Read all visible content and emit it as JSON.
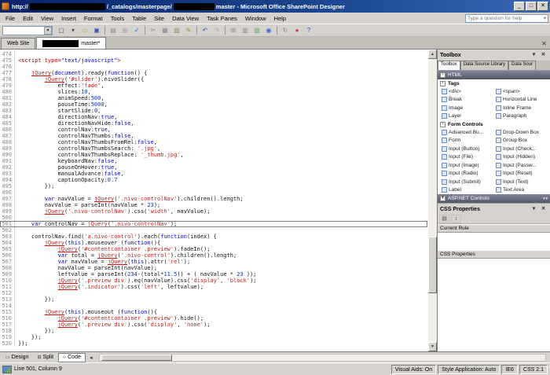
{
  "icons": {
    "chevron-down": "▾",
    "close": "✕",
    "scroll-up": "▲",
    "scroll-down": "▼",
    "categorize": "▤",
    "sort": "↕",
    "back": "◂",
    "minimize": "_",
    "maximize": "□"
  },
  "colors": {
    "titlebar": "#0a246a",
    "chrome": "#d6d3ce",
    "section_header": "#525767",
    "code_string": "#c21f1f",
    "code_keyword": "#0000d8",
    "redaction": "#000000"
  },
  "window": {
    "title_segments": [
      {
        "type": "text",
        "text": "http://"
      },
      {
        "type": "redacted",
        "w": 96
      },
      {
        "type": "text",
        "text": "/_catalogs/masterpage/"
      },
      {
        "type": "redacted",
        "w": 52
      },
      {
        "type": "text",
        "text": "master - Microsoft Office SharePoint Designer"
      }
    ],
    "controls": [
      {
        "name": "minimize-button",
        "glyph": "_"
      },
      {
        "name": "maximize-button",
        "glyph": "□"
      },
      {
        "name": "close-button",
        "glyph": "✕"
      }
    ]
  },
  "menu": {
    "items": [
      "File",
      "Edit",
      "View",
      "Insert",
      "Format",
      "Tools",
      "Table",
      "Site",
      "Data View",
      "Task Panes",
      "Window",
      "Help"
    ],
    "help_box": "Type a question for help"
  },
  "toolbar": {
    "icons": [
      {
        "name": "new-document-icon",
        "glyph": "▢",
        "color": "#555555"
      },
      {
        "name": "new-dropdown-chevron-icon",
        "glyph": "▾",
        "color": "#555555"
      },
      {
        "name": "open-folder-icon",
        "glyph": "▭",
        "color": "#c9a227"
      },
      {
        "name": "save-icon",
        "glyph": "▣",
        "color": "#3355aa"
      },
      {
        "sep": true
      },
      {
        "name": "print-icon",
        "glyph": "▤",
        "color": "#888888"
      },
      {
        "name": "print-preview-icon",
        "glyph": "◎",
        "color": "#888888"
      },
      {
        "name": "spelling-icon",
        "glyph": "✓",
        "color": "#3366cc"
      },
      {
        "sep": true
      },
      {
        "name": "cut-icon",
        "glyph": "✂",
        "color": "#888888"
      },
      {
        "name": "copy-icon",
        "glyph": "▦",
        "color": "#888888"
      },
      {
        "name": "paste-icon",
        "glyph": "▨",
        "color": "#998855"
      },
      {
        "name": "format-painter-icon",
        "glyph": "✎",
        "color": "#aa8833"
      },
      {
        "sep": true
      },
      {
        "name": "undo-icon",
        "glyph": "↶",
        "color": "#3366cc"
      },
      {
        "name": "redo-icon",
        "glyph": "↷",
        "color": "#aaaaaa"
      },
      {
        "sep": true
      },
      {
        "name": "insert-table-icon",
        "glyph": "⊞",
        "color": "#888888"
      },
      {
        "name": "insert-layer-icon",
        "glyph": "▥",
        "color": "#888888"
      },
      {
        "name": "insert-picture-icon",
        "glyph": "▧",
        "color": "#66aa66"
      },
      {
        "name": "hyperlink-icon",
        "glyph": "◉",
        "color": "#3366cc"
      },
      {
        "sep": true
      },
      {
        "name": "refresh-icon",
        "glyph": "↻",
        "color": "#888888"
      },
      {
        "name": "stop-icon",
        "glyph": "●",
        "color": "#bb4444"
      },
      {
        "name": "help-icon",
        "glyph": "?",
        "color": "#3355aa"
      }
    ]
  },
  "doc_tabs": [
    {
      "label": "Web Site"
    },
    {
      "redacted_width": 46,
      "label": "master*",
      "active": true
    }
  ],
  "editor": {
    "selected_line": 501,
    "lines": [
      {
        "n": 474,
        "t": ""
      },
      {
        "n": 475,
        "t": "<script type=\"text/javascript\">"
      },
      {
        "n": 476,
        "t": ""
      },
      {
        "n": 477,
        "t": "    jQuery(document).ready(function() {"
      },
      {
        "n": 478,
        "t": "        jQuery('#slider').nivoSlider({"
      },
      {
        "n": 479,
        "t": "            effect:'fade',"
      },
      {
        "n": 480,
        "t": "            slices:10,"
      },
      {
        "n": 481,
        "t": "            animSpeed:500,"
      },
      {
        "n": 482,
        "t": "            pauseTime:5000,"
      },
      {
        "n": 483,
        "t": "            startSlide:0,"
      },
      {
        "n": 484,
        "t": "            directionNav:true,"
      },
      {
        "n": 485,
        "t": "            directionNavHide:false,"
      },
      {
        "n": 486,
        "t": "            controlNav:true,"
      },
      {
        "n": 487,
        "t": "            controlNavThumbs:false,"
      },
      {
        "n": 488,
        "t": "            controlNavThumbsFromRel:false,"
      },
      {
        "n": 489,
        "t": "            controlNavThumbsSearch: '.jpg',"
      },
      {
        "n": 490,
        "t": "            controlNavThumbsReplace: '_thumb.jpg',"
      },
      {
        "n": 491,
        "t": "            keyboardNav:false,"
      },
      {
        "n": 492,
        "t": "            pauseOnHover:true,"
      },
      {
        "n": 493,
        "t": "            manualAdvance:false,"
      },
      {
        "n": 494,
        "t": "            captionOpacity:0.7"
      },
      {
        "n": 495,
        "t": "        });"
      },
      {
        "n": 496,
        "t": ""
      },
      {
        "n": 497,
        "t": "        var navValue = jQuery('.nivo-controlNav').children().length;"
      },
      {
        "n": 498,
        "t": "        navValue = parseInt(navValue * 23);"
      },
      {
        "n": 499,
        "t": "        jQuery('.nivo-controlNav').css('width', navValue);"
      },
      {
        "n": 500,
        "t": ""
      },
      {
        "n": 501,
        "t": "    var controlNav = jQuery('.nivo-controlNav');",
        "selected": true
      },
      {
        "n": 502,
        "t": ""
      },
      {
        "n": 503,
        "t": "    controlNav.find('a.nivo-control').each(function(index) {"
      },
      {
        "n": 504,
        "t": "        jQuery(this).mouseover (function(){"
      },
      {
        "n": 505,
        "t": "            jQuery('#contentcontainer .preview').fadeIn();"
      },
      {
        "n": 506,
        "t": "            var total = jQuery('.nivo-control').children().length;"
      },
      {
        "n": 507,
        "t": "            var navValue = jQuery(this).attr('rel');"
      },
      {
        "n": 508,
        "t": "            navValue = parseInt(navValue);"
      },
      {
        "n": 509,
        "t": "            leftvalue = parseInt(234-(total*11.5)) + ( navValue * 23 ));"
      },
      {
        "n": 510,
        "t": "            jQuery('.preview div').eq(navValue).css('display', 'block');"
      },
      {
        "n": 511,
        "t": "            jQuery('.indicator').css('left', leftvalue);"
      },
      {
        "n": 512,
        "t": ""
      },
      {
        "n": 513,
        "t": "        });"
      },
      {
        "n": 514,
        "t": ""
      },
      {
        "n": 515,
        "t": "        jQuery(this).mouseout (function(){"
      },
      {
        "n": 516,
        "t": "            jQuery('#contentcontainer .preview').hide();"
      },
      {
        "n": 517,
        "t": "            jQuery('.preview div').css('display', 'none');"
      },
      {
        "n": 518,
        "t": "        });"
      },
      {
        "n": 519,
        "t": "    });"
      },
      {
        "n": 520,
        "t": "});"
      }
    ]
  },
  "toolbox": {
    "pane_title": "Toolbox",
    "pane_tabs": [
      "Toolbox",
      "Data Source Library",
      "Data Sour"
    ],
    "sections": [
      {
        "header": "HTML",
        "collapsed": false,
        "groups": [
          {
            "label": "Tags",
            "items": [
              {
                "icon": "div-tag-icon",
                "label": "<div>"
              },
              {
                "icon": "span-tag-icon",
                "label": "<span>"
              },
              {
                "icon": "break-icon",
                "label": "Break"
              },
              {
                "icon": "horizontal-line-icon",
                "label": "Horizontal Line"
              },
              {
                "icon": "image-icon",
                "label": "Image"
              },
              {
                "icon": "inline-frame-icon",
                "label": "Inline Frame"
              },
              {
                "icon": "layer-icon",
                "label": "Layer"
              },
              {
                "icon": "paragraph-icon",
                "label": "Paragraph"
              }
            ]
          },
          {
            "label": "Form Controls",
            "items": [
              {
                "icon": "advanced-button-icon",
                "label": "Advanced Bu..."
              },
              {
                "icon": "drop-down-box-icon",
                "label": "Drop-Down Box"
              },
              {
                "icon": "form-icon",
                "label": "Form"
              },
              {
                "icon": "group-box-icon",
                "label": "Group Box"
              },
              {
                "icon": "input-button-icon",
                "label": "Input (Button)"
              },
              {
                "icon": "input-checkbox-icon",
                "label": "Input (Check..."
              },
              {
                "icon": "input-file-icon",
                "label": "Input (File)"
              },
              {
                "icon": "input-hidden-icon",
                "label": "Input (Hidden)"
              },
              {
                "icon": "input-image-icon",
                "label": "Input (Image)"
              },
              {
                "icon": "input-password-icon",
                "label": "Input (Passw..."
              },
              {
                "icon": "input-radio-icon",
                "label": "Input (Radio)"
              },
              {
                "icon": "input-reset-icon",
                "label": "Input (Reset)"
              },
              {
                "icon": "input-submit-icon",
                "label": "Input (Submit)"
              },
              {
                "icon": "input-text-icon",
                "label": "Input (Text)"
              },
              {
                "icon": "label-icon",
                "label": "Label"
              },
              {
                "icon": "text-area-icon",
                "label": "Text Area"
              }
            ]
          }
        ]
      },
      {
        "header": "ASP.NET Controls",
        "collapsed": true,
        "scroll": true,
        "groups": []
      }
    ]
  },
  "css_pane": {
    "title": "CSS Properties",
    "sections": [
      "Current Rule",
      "CSS Properties"
    ]
  },
  "view_bar": {
    "tabs": [
      {
        "icon": "design-view-icon",
        "glyph": "▭",
        "label": "Design"
      },
      {
        "icon": "split-view-icon",
        "glyph": "⊟",
        "label": "Split"
      },
      {
        "icon": "code-view-icon",
        "glyph": "‹›",
        "label": "Code",
        "active": true
      }
    ]
  },
  "status_bar": {
    "position": "Line 501, Column 9",
    "right": [
      "Visual Aids: On",
      "Style Application: Auto",
      "IE6",
      "CSS 2.1"
    ]
  }
}
